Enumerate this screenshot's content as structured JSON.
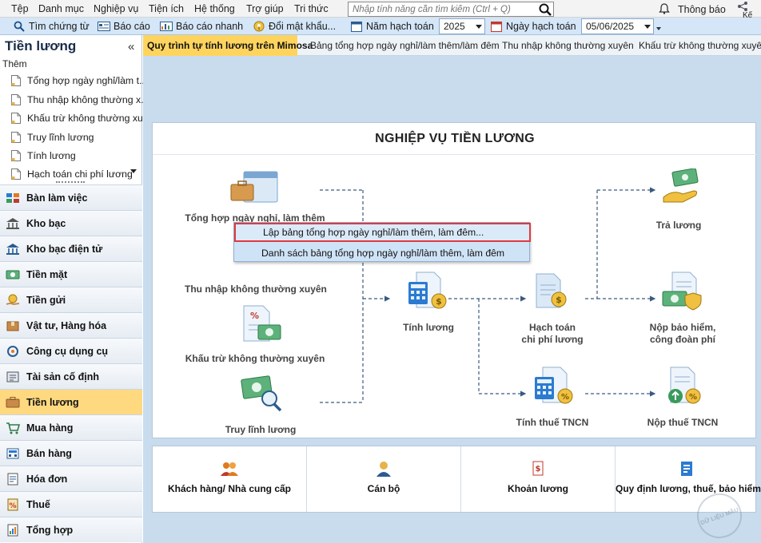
{
  "menu": [
    "Tệp",
    "Danh mục",
    "Nghiệp vụ",
    "Tiện ích",
    "Hệ thống",
    "Trợ giúp",
    "Tri thức"
  ],
  "search": {
    "placeholder": "Nhập tính năng cần tìm kiếm (Ctrl + Q)"
  },
  "notifications_label": "Thông báo",
  "knowledge_label": "Kế",
  "toolbar": {
    "find_voucher": "Tìm chứng từ",
    "reports": "Báo cáo",
    "quick_report": "Báo cáo nhanh",
    "change_password": "Đổi mật khẩu...",
    "fiscal_year_label": "Năm hạch toán",
    "fiscal_year_value": "2025",
    "posting_date_label": "Ngày hạch toán",
    "posting_date_value": "05/06/2025"
  },
  "left": {
    "title": "Tiền lương",
    "collapse": "«",
    "add_label": "Thêm",
    "favorites": [
      "Tổng hợp ngày nghỉ/làm t...",
      "Thu nhập không thường x...",
      "Khấu trừ không thường xu...",
      "Truy lĩnh lương",
      "Tính lương",
      "Hạch toán chi phí lương"
    ],
    "modules": [
      "Bàn làm việc",
      "Kho bạc",
      "Kho bạc điện tử",
      "Tiền mặt",
      "Tiền gửi",
      "Vật tư, Hàng hóa",
      "Công cụ dụng cụ",
      "Tài sản cố định",
      "Tiền lương",
      "Mua hàng",
      "Bán hàng",
      "Hóa đơn",
      "Thuế",
      "Tổng hợp"
    ],
    "active_module": "Tiền lương"
  },
  "tabs": [
    "Quy trình tự tính lương trên Mimosa",
    "Bảng tổng hợp ngày nghỉ/làm thêm/làm đêm",
    "Thu nhập không thường xuyên",
    "Khấu trừ không thường xuyên"
  ],
  "active_tab": "Quy trình tự tính lương trên Mimosa",
  "process": {
    "title": "NGHIỆP VỤ TIỀN LƯƠNG",
    "nodes": {
      "summary": "Tổng hợp ngày nghỉ, làm thêm",
      "income": "Thu nhập không thường xuyên",
      "deduction": "Khấu trừ không thường xuyên",
      "backpay": "Truy lĩnh lương",
      "calc": "Tính lương",
      "posting_1": "Hạch toán",
      "posting_2": "chi phí lương",
      "pay": "Trả lương",
      "insurance_1": "Nộp bảo hiểm,",
      "insurance_2": "công đoàn phí",
      "pit_calc": "Tính thuế TNCN",
      "pit_pay": "Nộp thuế TNCN"
    }
  },
  "context_menu": [
    "Lập bảng tổng hợp ngày nghỉ/làm thêm, làm đêm...",
    "Danh sách bảng tổng hợp ngày nghỉ/làm thêm, làm đêm"
  ],
  "bottom": [
    "Khách hàng/ Nhà cung cấp",
    "Cán bộ",
    "Khoản lương",
    "Quy định lương, thuế, bảo hiểm"
  ],
  "watermark": "DỮ LIỆU MẪU",
  "colors": {
    "toolbar": "#d4e6f7",
    "active_tab": "#ffd45e",
    "active_module": "#ffd980",
    "main_bg": "#c8dcee",
    "highlight_border": "#e0393e",
    "money_green": "#3a9a5c",
    "doc_blue": "#a9c7e6"
  }
}
